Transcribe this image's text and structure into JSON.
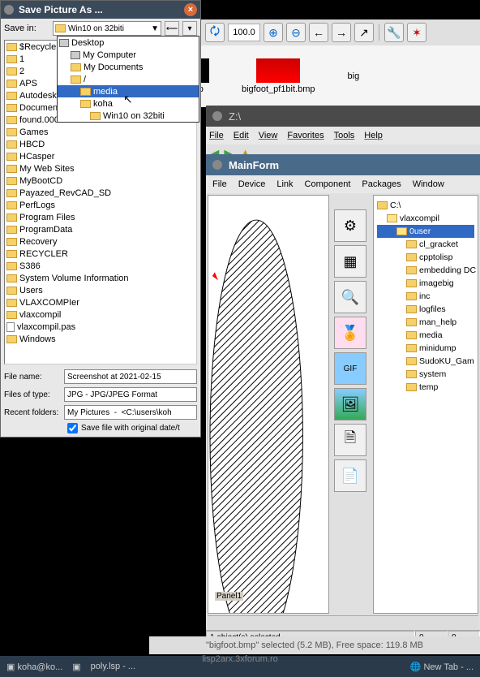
{
  "toolbar": {
    "zoom_value": "100.0"
  },
  "files": {
    "f1": "bot.bmp",
    "f2": "bigfoot_pf1bit.bmp",
    "f3": "big"
  },
  "z_window": {
    "title": "Z:\\",
    "menu": {
      "file": "File",
      "edit": "Edit",
      "view": "View",
      "favorites": "Favorites",
      "tools": "Tools",
      "help": "Help"
    }
  },
  "mainform": {
    "title": "MainForm",
    "menu": {
      "file": "File",
      "device": "Device",
      "link": "Link",
      "component": "Component",
      "packages": "Packages",
      "window": "Window"
    },
    "panel_label": "Panel1",
    "tree": {
      "root": "C:\\",
      "vlax": "vlaxcompil",
      "ouser": "0user",
      "items": [
        "cl_gracket",
        "cpptolisp",
        "embedding DC",
        "imagebig",
        "inc",
        "logfiles",
        "man_help",
        "media",
        "minidump",
        "SudoKU_Gam",
        "system",
        "temp"
      ]
    },
    "status": {
      "selected": "1 object(s) selected",
      "v1": "0",
      "v2": "0"
    }
  },
  "main_status": "\"bigfoot.bmp\" selected (5.2 MB), Free space: 119.8 MB",
  "taskbar": {
    "item1": "koha@ko...",
    "item2": "lisp2arx.3xforum.ro",
    "item3": "poly.lsp - ...",
    "item4": "New Tab - ..."
  },
  "save_dialog": {
    "title": "Save Picture As ...",
    "save_in_label": "Save in:",
    "save_in_value": "Win10 on 32biti",
    "folders": [
      "$Recycle.",
      "1",
      "2",
      "APS",
      "Autodesk",
      "Documen",
      "found.000",
      "Games",
      "HBCD",
      "HCasper",
      "My Web Sites",
      "MyBootCD",
      "Payazed_RevCAD_SD",
      "PerfLogs",
      "Program Files",
      "ProgramData",
      "Recovery",
      "RECYCLER",
      "S386",
      "System Volume Information",
      "Users",
      "VLAXCOMPIer"
    ],
    "file_items": [
      "vlaxcompil",
      "vlaxcompil.pas",
      "Windows"
    ],
    "filename_label": "File name:",
    "filename_value": "Screenshot at 2021-02-15",
    "filetype_label": "Files of type:",
    "filetype_value": "JPG - JPG/JPEG Format",
    "recent_label": "Recent folders:",
    "recent_value": "My Pictures  -  <C:\\users\\koh",
    "checkbox_label": "Save file with original date/t"
  },
  "dropdown": {
    "desktop": "Desktop",
    "mycomputer": "My Computer",
    "mydocs": "My Documents",
    "slash": "/",
    "media": "media",
    "koha": "koha",
    "win10": "Win10 on 32biti"
  }
}
